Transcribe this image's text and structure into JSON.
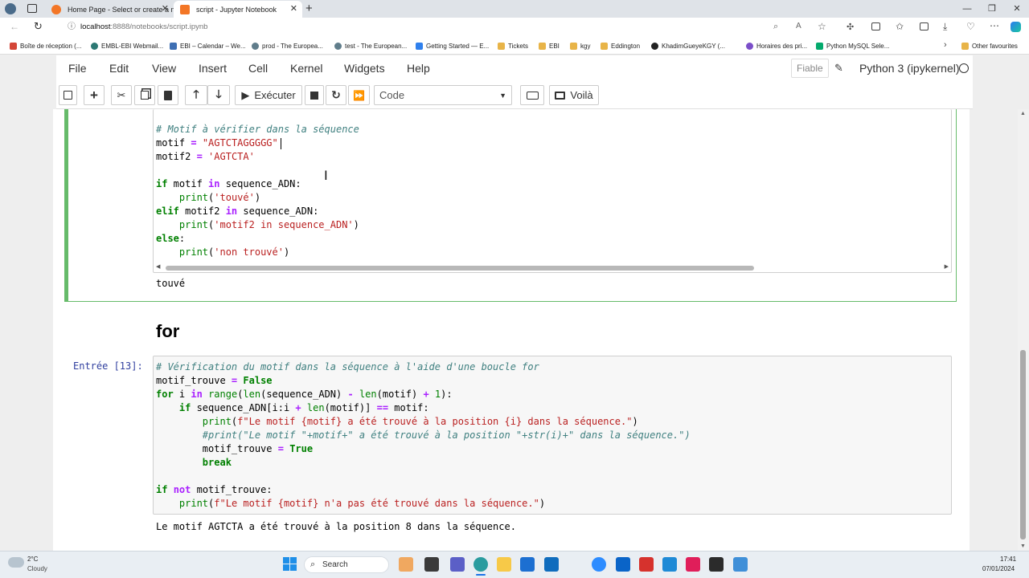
{
  "browser": {
    "tabs": [
      {
        "title": "Home Page - Select or create a n"
      },
      {
        "title": "script - Jupyter Notebook"
      }
    ],
    "address_host": "localhost",
    "address_path": ":8888/notebooks/script.ipynb",
    "bookmarks": [
      "Boîte de réception (...",
      "EMBL-EBI Webmail...",
      "EBI – Calendar – We...",
      "prod - The Europea...",
      "test - The European...",
      "Getting Started — E...",
      "Tickets",
      "EBI",
      "kgy",
      "Eddington",
      "KhadimGueyeKGY (...",
      "Horaires des pri...",
      "Python MySQL Sele...",
      "Other favourites"
    ]
  },
  "jupyter": {
    "menus": [
      "File",
      "Edit",
      "View",
      "Insert",
      "Cell",
      "Kernel",
      "Widgets",
      "Help"
    ],
    "trusted": "Fiable",
    "kernel": "Python 3 (ipykernel)",
    "run_label": "Exécuter",
    "cell_type": "Code",
    "voila_label": "Voilà"
  },
  "cells": {
    "cell1": {
      "comment": "# Motif à vérifier dans la séquence",
      "motif_value": "\"AGTCTAGGGGG\"",
      "motif2_value": "'AGTCTA'",
      "print1": "'touvé'",
      "print2": "'motif2 in sequence_ADN'",
      "print3": "'non trouvé'",
      "output": "touvé"
    },
    "heading": "for",
    "cell2": {
      "prompt": "Entrée [13]:",
      "comment": "# Vérification du motif dans la séquence à l'aide d'une boucle for",
      "fstr1": "f\"Le motif {motif} a été trouvé à la position {i} dans la séquence.\"",
      "hashprint": "#print(\"Le motif \"+motif+\" a été trouvé à la position \"+str(i)+\" dans la séquence.\")",
      "fstr2": "f\"Le motif {motif} n'a pas été trouvé dans la séquence.\"",
      "output": "Le motif AGTCTA a été trouvé à la position 8 dans la séquence."
    }
  },
  "taskbar": {
    "temp": "2°C",
    "weather": "Cloudy",
    "search": "Search",
    "time": "17:41",
    "date": "07/01/2024"
  }
}
